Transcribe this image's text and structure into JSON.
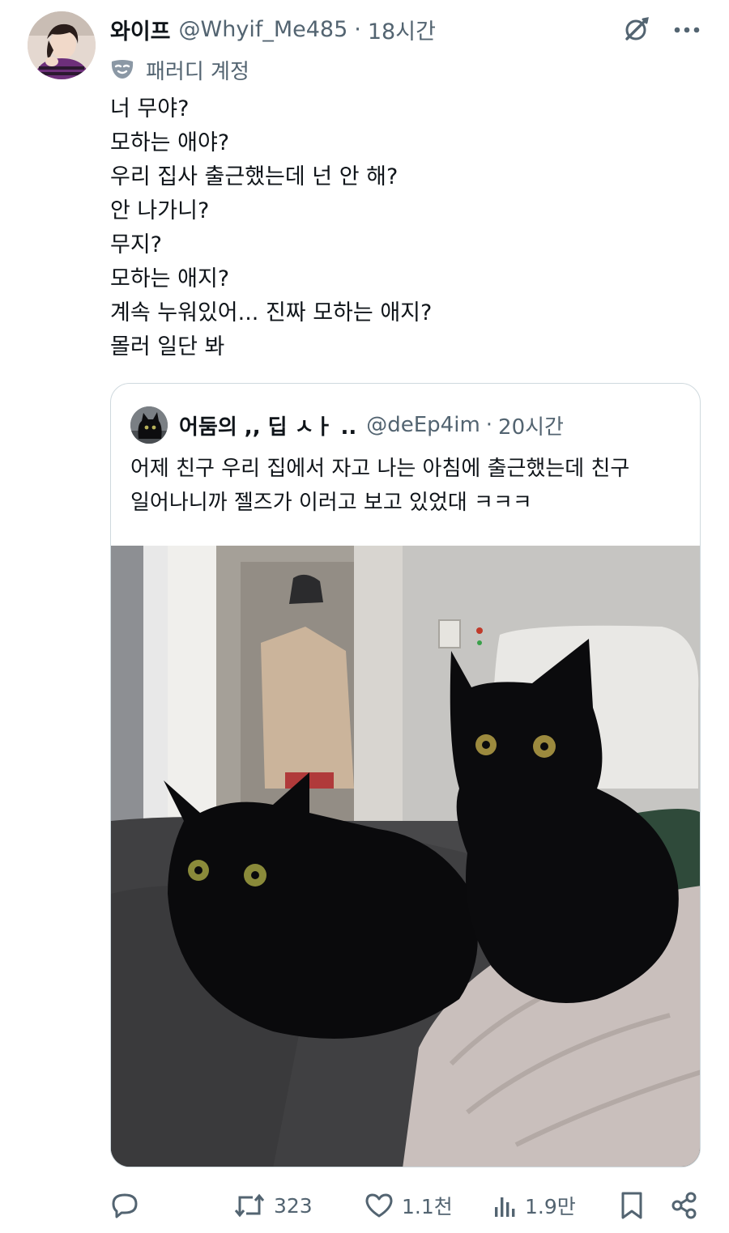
{
  "author": {
    "name": "와이프",
    "handle": "@Whyif_Me485",
    "separator": "·",
    "time": "18시간"
  },
  "parody_label": "패러디 계정",
  "body_lines": [
    "너 무야?",
    "모하는 애야?",
    "우리 집사 출근했는데 넌 안 해?",
    "안 나가니?",
    "무지?",
    "모하는 애지?",
    "계속 누워있어... 진짜 모하는 애지?",
    "몰러 일단 봐"
  ],
  "quoted": {
    "name": "어둠의 ,, 딥 ㅅㅏ ..",
    "handle": "@deEp4im",
    "separator": "·",
    "time": "20시간",
    "text_lines": [
      "어제 친구 우리 집에서 자고 나는 아침에 출근했는데 친구",
      "일어나니까 젤즈가 이러고 보고 있었대 ㅋㅋㅋ"
    ],
    "photo_icon": "photo-two-black-cats"
  },
  "actions": {
    "reply_icon": "reply-icon",
    "retweet_count": "323",
    "like_count": "1.1천",
    "views_count": "1.9만",
    "bookmark_icon": "bookmark-icon",
    "share_icon": "share-icon"
  },
  "header_icons": [
    "grok-icon",
    "more-icon"
  ],
  "colors": {
    "text": "#0f1419",
    "secondary": "#536471",
    "border": "#cfd9de",
    "accent": "#1d9bf0"
  }
}
